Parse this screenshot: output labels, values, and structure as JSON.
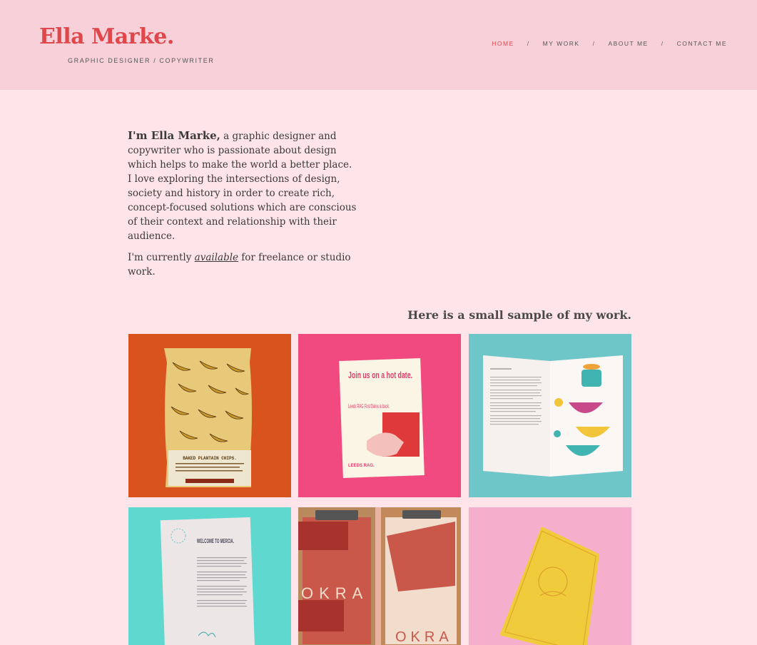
{
  "brand": {
    "name": "Ella Marke.",
    "tagline": "GRAPHIC DESIGNER / COPYWRITER"
  },
  "nav": {
    "items": [
      {
        "label": "HOME",
        "active": true
      },
      {
        "label": "MY WORK"
      },
      {
        "label": "ABOUT ME"
      },
      {
        "label": "CONTACT ME"
      }
    ],
    "separator": "/"
  },
  "intro": {
    "lead": "I'm Ella Marke,",
    "body": " a graphic designer and copywriter who is passionate about design which helps to make the world a better place. I love exploring the intersections of  design, society and history in order to create rich, concept-focused solutions which are conscious of  their context and relationship with their audience.",
    "avail_prefix": "I'm currently ",
    "avail_link": "available",
    "avail_suffix": " for freelance or studio work."
  },
  "work": {
    "heading": "Here is a small sample of my work.",
    "items": [
      {
        "bg": "#d9531e",
        "chip_label": "BAKED PLANTAIN CHIPS."
      },
      {
        "bg": "#f04a80",
        "poster_headline": "Join us on a hot date.",
        "poster_sub": "Leeds RAG First Dates is back.",
        "poster_footer": "LEEDS RAG."
      },
      {
        "bg": "#6fc6c9"
      },
      {
        "bg": "#5fd8cf",
        "letter_title": "WELCOME TO MERCIA."
      },
      {
        "bg": "#e9b3a2",
        "letters": "OKRA"
      },
      {
        "bg": "#f6aecd"
      }
    ]
  },
  "colors": {
    "accent": "#e0474a",
    "header_bg": "#f8d0da",
    "page_bg": "#ffe4ea"
  }
}
